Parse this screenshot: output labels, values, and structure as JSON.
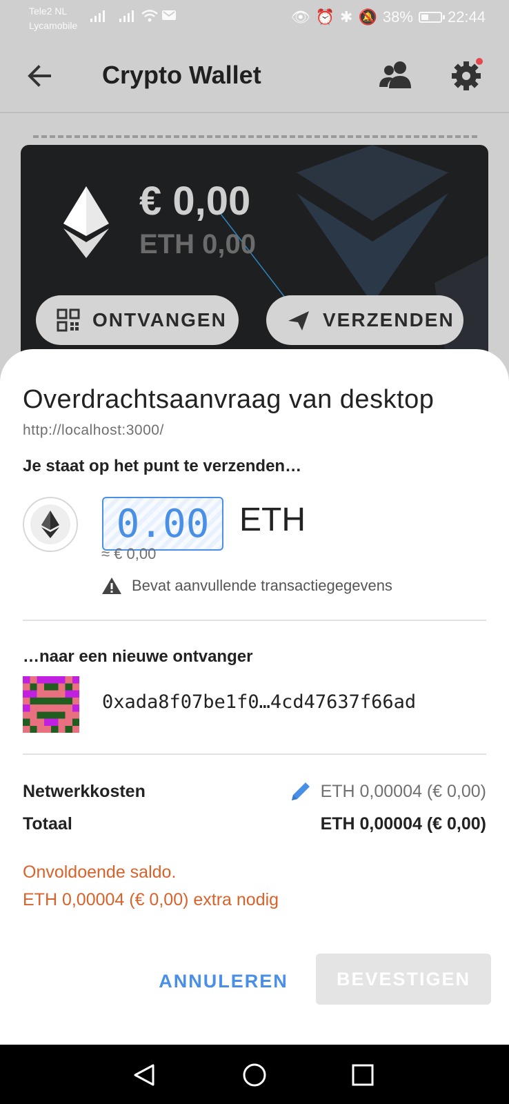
{
  "status_bar": {
    "carrier_1": "Tele2 NL",
    "carrier_2": "Lycamobile",
    "battery": "38%",
    "time": "22:44"
  },
  "app_bar": {
    "title": "Crypto Wallet",
    "icons": [
      "back-arrow-icon",
      "contacts-icon",
      "gear-icon"
    ]
  },
  "wallet_card": {
    "fiat_balance": "€ 0,00",
    "eth_balance": "ETH  0,00",
    "receive_label": "ONTVANGEN",
    "send_label": "VERZENDEN"
  },
  "sheet": {
    "title": "Overdrachtsaanvraag van desktop",
    "origin": "http://localhost:3000/",
    "send_heading": "Je staat op het punt te verzenden…",
    "amount": "0.00",
    "amount_unit": "ETH",
    "fiat_approx": "≈ € 0,00",
    "data_warning": "Bevat aanvullende transactiegegevens",
    "recipient_heading": "…naar een nieuwe ontvanger",
    "recipient_address": "0xada8f07be1f0…4cd47637f66ad",
    "fee_label": "Netwerkkosten",
    "fee_value": "ETH  0,00004 (€ 0,00)",
    "total_label": "Totaal",
    "total_value": "ETH  0,00004 (€ 0,00)",
    "error_line_1": "Onvoldoende saldo.",
    "error_line_2": "ETH  0,00004 (€ 0,00) extra nodig",
    "cancel_label": "ANNULEREN",
    "confirm_label": "BEVESTIGEN"
  },
  "colors": {
    "accent": "#4a8fe6",
    "error": "#d9622b",
    "card": "#1e1f20",
    "disabled_button": "#e4e4e4"
  }
}
